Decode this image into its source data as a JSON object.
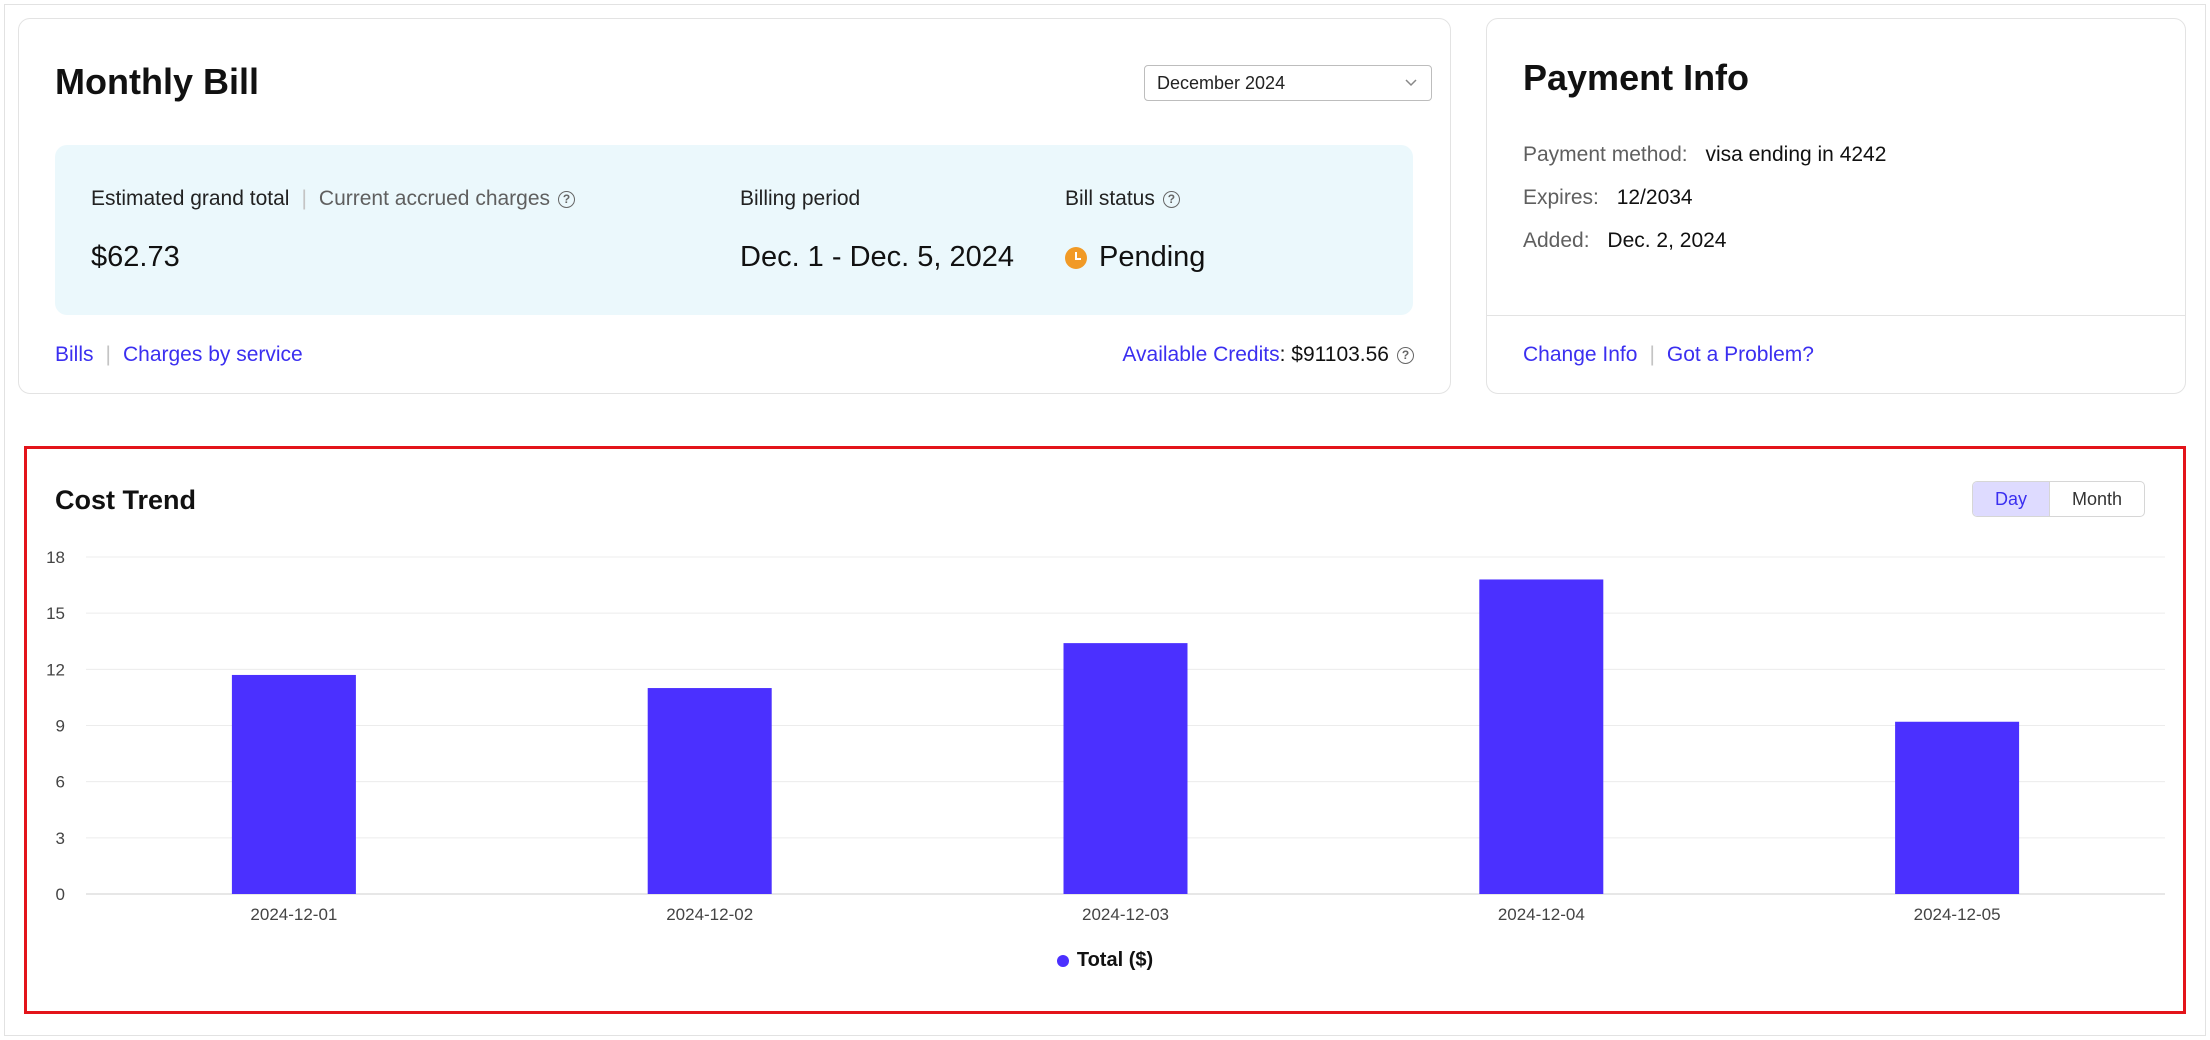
{
  "bill": {
    "title": "Monthly Bill",
    "month_select": "December 2024",
    "estimated_label": "Estimated grand total",
    "accrued_label": "Current accrued charges",
    "total_value": "$62.73",
    "period_label": "Billing period",
    "period_value": "Dec. 1 - Dec. 5, 2024",
    "status_label": "Bill status",
    "status_value": "Pending",
    "links": {
      "bills": "Bills",
      "charges": "Charges by service"
    },
    "credits_label": "Available Credits",
    "credits_value": "$91103.56"
  },
  "payment": {
    "title": "Payment Info",
    "method_label": "Payment method:",
    "method_value": "visa ending in 4242",
    "expires_label": "Expires:",
    "expires_value": "12/2034",
    "added_label": "Added:",
    "added_value": "Dec. 2, 2024",
    "links": {
      "change": "Change Info",
      "problem": "Got a Problem?"
    }
  },
  "trend": {
    "title": "Cost Trend",
    "toggle": {
      "day": "Day",
      "month": "Month",
      "active": "Day"
    }
  },
  "colors": {
    "accent": "#3b2ff0",
    "bar": "#4b30ff",
    "highlight": "#e3141a",
    "summary_bg": "#ebf8fc",
    "pending": "#f19a26"
  },
  "chart_data": {
    "type": "bar",
    "title": "Cost Trend",
    "categories": [
      "2024-12-01",
      "2024-12-02",
      "2024-12-03",
      "2024-12-04",
      "2024-12-05"
    ],
    "series": [
      {
        "name": "Total ($)",
        "values": [
          11.7,
          11.0,
          13.4,
          16.8,
          9.2
        ]
      }
    ],
    "yticks": [
      "0",
      "3",
      "6",
      "9",
      "12",
      "15",
      "18"
    ],
    "ylim": [
      0,
      18
    ],
    "grid": true,
    "legend": "bottom-center"
  }
}
